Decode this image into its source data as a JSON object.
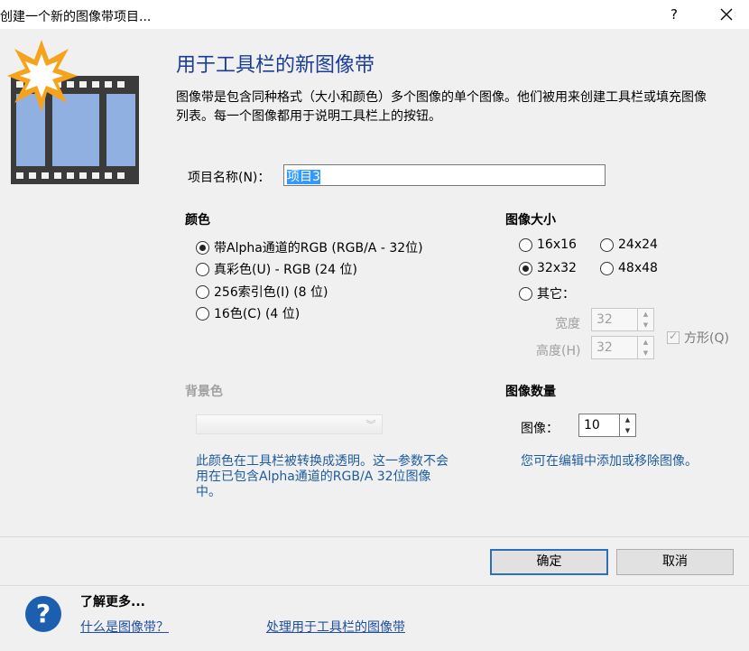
{
  "window": {
    "title": "创建一个新的图像带项目...",
    "help_glyph": "?"
  },
  "header": {
    "heading": "用于工具栏的新图像带",
    "description": "图像带是包含同种格式（大小和颜色）多个图像的单个图像。他们被用来创建工具栏或填充图像列表。每一个图像都用于说明工具栏上的按钮。"
  },
  "project_name": {
    "label": "项目名称(N)：",
    "value": "项目3"
  },
  "color": {
    "title": "颜色",
    "options": [
      {
        "label": "带Alpha通道的RGB (RGB/A - 32位)",
        "checked": true
      },
      {
        "label": "真彩色(U) - RGB (24 位)",
        "checked": false
      },
      {
        "label": "256索引色(I) (8 位)",
        "checked": false
      },
      {
        "label": "16色(C) (4 位)",
        "checked": false
      }
    ]
  },
  "image_size": {
    "title": "图像大小",
    "options": [
      {
        "label": "16x16",
        "checked": false
      },
      {
        "label": "24x24",
        "checked": false
      },
      {
        "label": "32x32",
        "checked": true
      },
      {
        "label": "48x48",
        "checked": false
      },
      {
        "label": "其它：",
        "checked": false
      }
    ],
    "width_label": "宽度",
    "width_value": "32",
    "height_label": "高度(H)",
    "height_value": "32",
    "square_label": "方形(Q)",
    "square_checked": true
  },
  "background": {
    "title": "背景色",
    "note": "此颜色在工具栏被转换成透明。这一参数不会用在已包含Alpha通道的RGB/A 32位图像中。"
  },
  "image_count": {
    "title": "图像数量",
    "label": "图像：",
    "value": "10",
    "note": "您可在编辑中添加或移除图像。"
  },
  "buttons": {
    "ok": "确定",
    "cancel": "取消"
  },
  "footer": {
    "learn_more": "了解更多...",
    "link1": "什么是图像带？",
    "link2": "处理用于工具栏的图像带"
  },
  "colors": {
    "heading": "#1a3d99",
    "link": "#1f4fa0",
    "note": "#1f5b9c",
    "ok_border": "#2f6fb5"
  },
  "icons": [
    "filmstrip-icon",
    "starburst-icon",
    "help-circle-icon",
    "close-icon",
    "spin-up-icon",
    "spin-down-icon"
  ]
}
